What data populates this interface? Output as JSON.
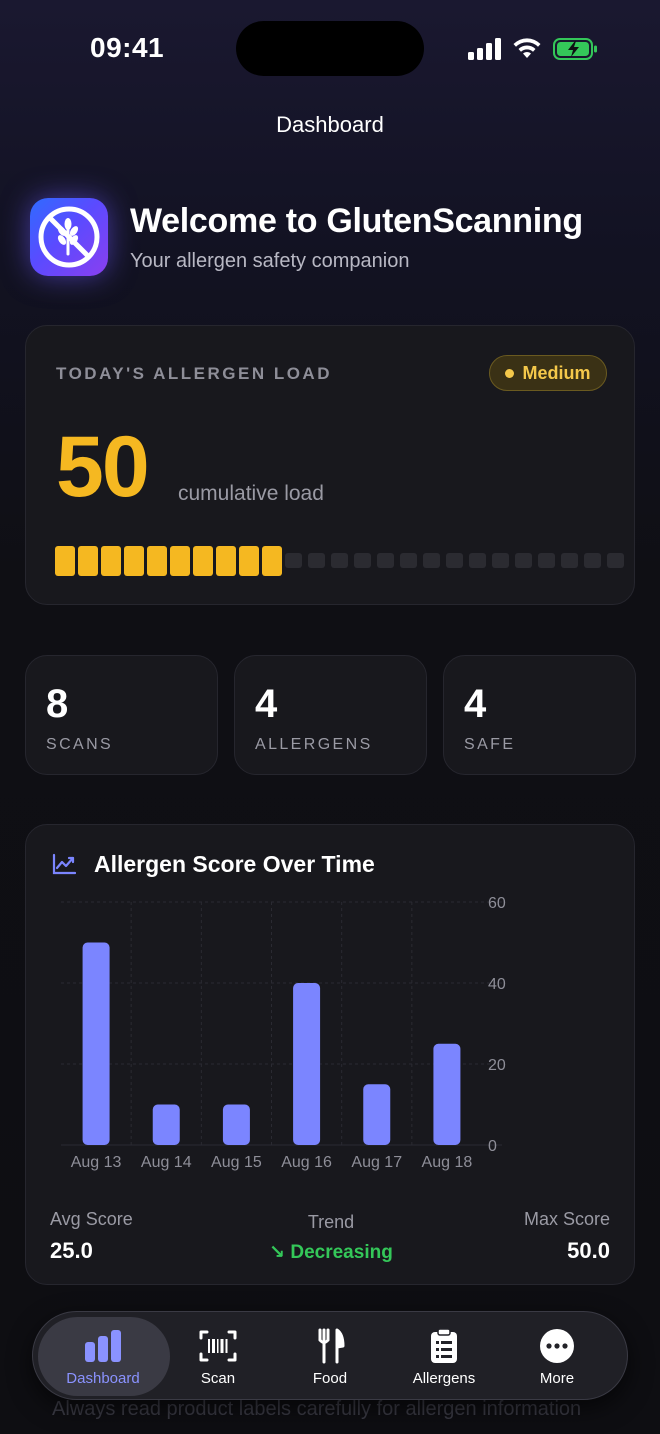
{
  "status_bar": {
    "time": "09:41"
  },
  "nav": {
    "title": "Dashboard"
  },
  "header": {
    "title": "Welcome to GlutenScanning",
    "subtitle": "Your allergen safety companion"
  },
  "allergen_load": {
    "label": "TODAY'S ALLERGEN LOAD",
    "level": "Medium",
    "value": "50",
    "unit": "cumulative load",
    "segments_filled": 10,
    "segments_total": 25,
    "fill_color": "#f5b821",
    "empty_color": "#2b2b31"
  },
  "stats": [
    {
      "value": "8",
      "label": "SCANS"
    },
    {
      "value": "4",
      "label": "ALLERGENS"
    },
    {
      "value": "4",
      "label": "SAFE"
    }
  ],
  "chart_section": {
    "title": "Allergen Score Over Time",
    "avg_label": "Avg Score",
    "avg_value": "25.0",
    "trend_label": "Trend",
    "trend_value": "↘ Decreasing",
    "max_label": "Max Score",
    "max_value": "50.0"
  },
  "chart_data": {
    "type": "bar",
    "title": "Allergen Score Over Time",
    "categories": [
      "Aug 13",
      "Aug 14",
      "Aug 15",
      "Aug 16",
      "Aug 17",
      "Aug 18"
    ],
    "values": [
      50,
      10,
      10,
      40,
      15,
      25
    ],
    "ylim": [
      0,
      60
    ],
    "yticks": [
      "0",
      "20",
      "40",
      "60"
    ],
    "grid": true,
    "bar_color": "#7b85ff"
  },
  "footer_note": "Always read product labels carefully for allergen information",
  "tabs": [
    {
      "label": "Dashboard",
      "icon": "chart-bars-icon",
      "active": true
    },
    {
      "label": "Scan",
      "icon": "barcode-scan-icon",
      "active": false
    },
    {
      "label": "Food",
      "icon": "fork-knife-icon",
      "active": false
    },
    {
      "label": "Allergens",
      "icon": "clipboard-list-icon",
      "active": false
    },
    {
      "label": "More",
      "icon": "more-dots-icon",
      "active": false
    }
  ],
  "colors": {
    "accent": "#7b85ff",
    "warning": "#f5b821",
    "success": "#34c759"
  }
}
